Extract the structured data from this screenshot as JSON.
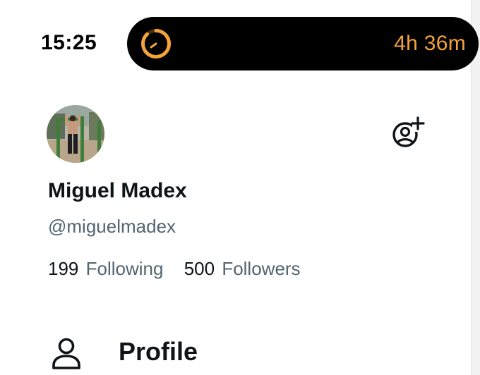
{
  "status_bar": {
    "time": "15:25",
    "live_activity": {
      "icon": "timer-ring-icon",
      "remaining": "4h 36m",
      "accent": "#f4a33a"
    }
  },
  "profile": {
    "display_name": "Miguel Madex",
    "handle": "@miguelmadex",
    "avatar": "avatar-photo",
    "stats": {
      "following_count": "199",
      "following_label": "Following",
      "followers_count": "500",
      "followers_label": "Followers"
    }
  },
  "actions": {
    "follow_icon": "add-account-icon"
  },
  "nav": {
    "items": [
      {
        "icon": "person-icon",
        "label": "Profile"
      }
    ]
  },
  "colors": {
    "text_primary": "#0f1419",
    "text_secondary": "#536471",
    "island_bg": "#000000"
  }
}
